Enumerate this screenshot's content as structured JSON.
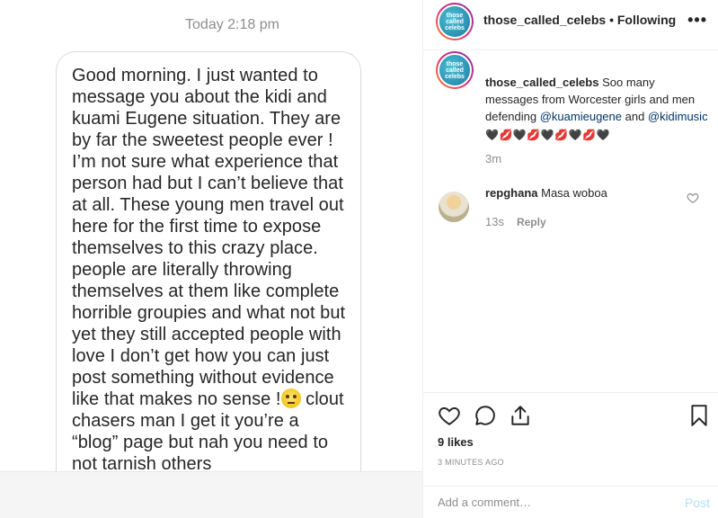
{
  "message": {
    "timestamp": "Today 2:18 pm",
    "text_part1": "Good morning.  I just wanted to message you about the kidi and kuami Eugene situation. They are by far the sweetest people ever ! I’m not sure what experience that person had but I can’t believe that at all. These young men travel out here for the first time to expose themselves to this crazy place. people are literally throwing themselves at them like complete horrible groupies and what not but yet they still accepted people with love I don’t get how you can just post something without evidence like that makes no sense !",
    "emoji": "face-with-rolling-eyes",
    "text_part2": " clout chasers man I get it you’re a “blog” page but nah you need to not tarnish others"
  },
  "post": {
    "username": "those_called_celebs",
    "separator": " • ",
    "follow_status": "Following",
    "more": "•••",
    "avatar_text": "those called celebs",
    "caption": {
      "username": "those_called_celebs",
      "text1": " Soo many messages from Worcester girls and men defending ",
      "mention1": "@kuamieugene",
      "text2": " and ",
      "mention2": "@kidimusic",
      "hearts": " 🖤💋🖤💋🖤💋🖤💋🖤",
      "time": "3m"
    },
    "comment": {
      "username": "repghana",
      "text": " Masa woboa",
      "time": "13s",
      "reply": "Reply"
    },
    "likes": "9 likes",
    "posted_ago": "3 MINUTES AGO",
    "add_comment_placeholder": "Add a comment…",
    "post_label": "Post"
  },
  "colors": {
    "mention": "#003569",
    "post_disabled": "#b2dffc",
    "muted": "#8e8e8e"
  }
}
